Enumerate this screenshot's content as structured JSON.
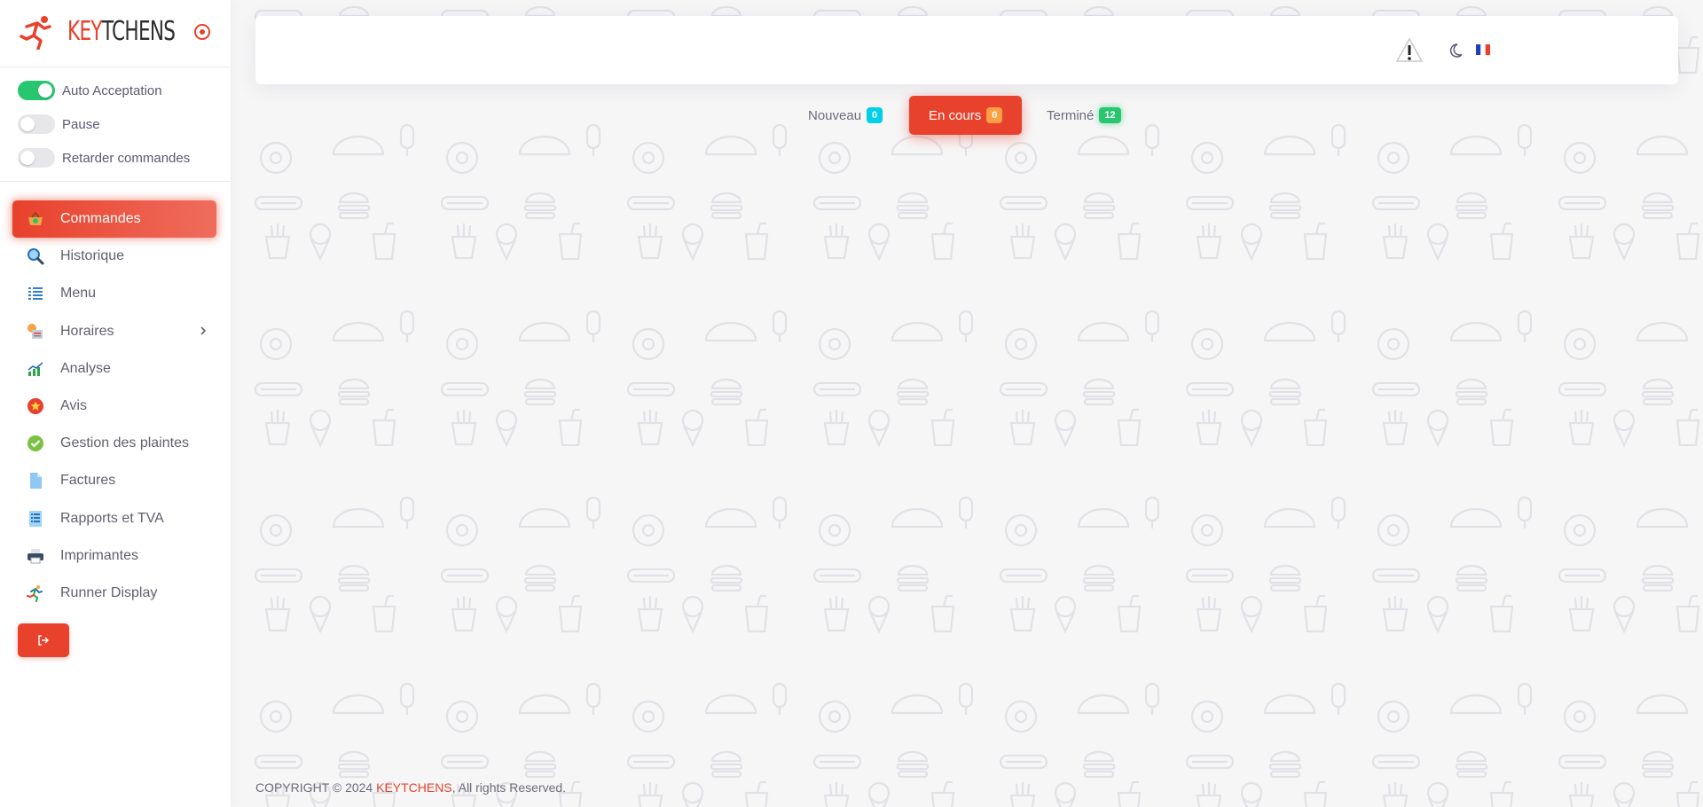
{
  "brand": {
    "name_red": "KEY",
    "name_dark": "TCHENS"
  },
  "toggles": [
    {
      "label": "Auto Acceptation",
      "on": true
    },
    {
      "label": "Pause",
      "on": false
    },
    {
      "label": "Retarder commandes",
      "on": false
    }
  ],
  "nav": [
    {
      "label": "Commandes",
      "icon": "basket-icon",
      "active": true
    },
    {
      "label": "Historique",
      "icon": "magnifier-icon"
    },
    {
      "label": "Menu",
      "icon": "list-icon"
    },
    {
      "label": "Horaires",
      "icon": "schedule-icon",
      "has_submenu": true
    },
    {
      "label": "Analyse",
      "icon": "chart-icon"
    },
    {
      "label": "Avis",
      "icon": "star-icon"
    },
    {
      "label": "Gestion des plaintes",
      "icon": "check-circle-icon"
    },
    {
      "label": "Factures",
      "icon": "document-icon"
    },
    {
      "label": "Rapports et TVA",
      "icon": "report-icon"
    },
    {
      "label": "Imprimantes",
      "icon": "printer-icon"
    },
    {
      "label": "Runner Display",
      "icon": "runner-icon"
    }
  ],
  "tabs": [
    {
      "label": "Nouveau",
      "count": "0",
      "active": false
    },
    {
      "label": "En cours",
      "count": "0",
      "active": true
    },
    {
      "label": "Terminé",
      "count": "12",
      "active": false
    }
  ],
  "footer": {
    "prefix": "COPYRIGHT © 2024",
    "brand": "KEYTCHENS",
    "suffix": ", All rights Reserved."
  },
  "colors": {
    "accent": "#e8412c",
    "success": "#28c76f",
    "info": "#00cfe8",
    "warning": "#ff9f43"
  }
}
